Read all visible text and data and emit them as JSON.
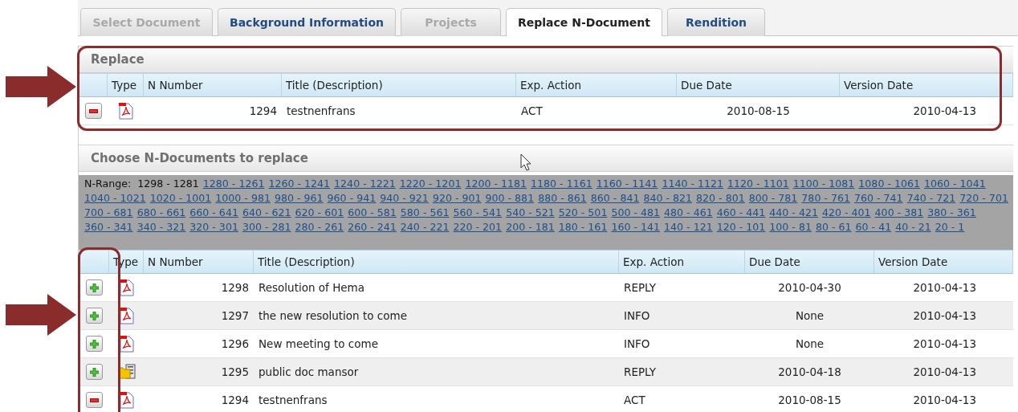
{
  "tabs": [
    {
      "label": "Select Document",
      "selected": false,
      "disabled": true
    },
    {
      "label": "Background Information",
      "selected": false,
      "disabled": false
    },
    {
      "label": "Projects",
      "selected": false,
      "disabled": true
    },
    {
      "label": "Replace N-Document",
      "selected": true,
      "disabled": false
    },
    {
      "label": "Rendition",
      "selected": false,
      "disabled": false
    }
  ],
  "replace": {
    "title": "Replace",
    "columns": [
      "Type",
      "N Number",
      "Title (Description)",
      "Exp. Action",
      "Due Date",
      "Version Date"
    ],
    "rows": [
      {
        "kind": "remove",
        "file": {
          "kind": "pdf"
        },
        "n_number": "1294",
        "title": "testnenfrans",
        "exp_action": "ACT",
        "due_date": "2010-08-15",
        "version_date": "2010-04-13"
      }
    ]
  },
  "choose": {
    "title": "Choose N-Documents to replace",
    "range_label": "N-Range:",
    "ranges": [
      {
        "label": "1298 - 1281",
        "selected": true
      },
      {
        "label": "1280 - 1261",
        "selected": false
      },
      {
        "label": "1260 - 1241",
        "selected": false
      },
      {
        "label": "1240 - 1221",
        "selected": false
      },
      {
        "label": "1220 - 1201",
        "selected": false
      },
      {
        "label": "1200 - 1181",
        "selected": false
      },
      {
        "label": "1180 - 1161",
        "selected": false
      },
      {
        "label": "1160 - 1141",
        "selected": false
      },
      {
        "label": "1140 - 1121",
        "selected": false
      },
      {
        "label": "1120 - 1101",
        "selected": false
      },
      {
        "label": "1100 - 1081",
        "selected": false
      },
      {
        "label": "1080 - 1061",
        "selected": false
      },
      {
        "label": "1060 - 1041",
        "selected": false
      },
      {
        "label": "1040 - 1021",
        "selected": false
      },
      {
        "label": "1020 - 1001",
        "selected": false
      },
      {
        "label": "1000 - 981",
        "selected": false
      },
      {
        "label": "980 - 961",
        "selected": false
      },
      {
        "label": "960 - 941",
        "selected": false
      },
      {
        "label": "940 - 921",
        "selected": false
      },
      {
        "label": "920 - 901",
        "selected": false
      },
      {
        "label": "900 - 881",
        "selected": false
      },
      {
        "label": "880 - 861",
        "selected": false
      },
      {
        "label": "860 - 841",
        "selected": false
      },
      {
        "label": "840 - 821",
        "selected": false
      },
      {
        "label": "820 - 801",
        "selected": false
      },
      {
        "label": "800 - 781",
        "selected": false
      },
      {
        "label": "780 - 761",
        "selected": false
      },
      {
        "label": "760 - 741",
        "selected": false
      },
      {
        "label": "740 - 721",
        "selected": false
      },
      {
        "label": "720 - 701",
        "selected": false
      },
      {
        "label": "700 - 681",
        "selected": false
      },
      {
        "label": "680 - 661",
        "selected": false
      },
      {
        "label": "660 - 641",
        "selected": false
      },
      {
        "label": "640 - 621",
        "selected": false
      },
      {
        "label": "620 - 601",
        "selected": false
      },
      {
        "label": "600 - 581",
        "selected": false
      },
      {
        "label": "580 - 561",
        "selected": false
      },
      {
        "label": "560 - 541",
        "selected": false
      },
      {
        "label": "540 - 521",
        "selected": false
      },
      {
        "label": "520 - 501",
        "selected": false
      },
      {
        "label": "500 - 481",
        "selected": false
      },
      {
        "label": "480 - 461",
        "selected": false
      },
      {
        "label": "460 - 441",
        "selected": false
      },
      {
        "label": "440 - 421",
        "selected": false
      },
      {
        "label": "420 - 401",
        "selected": false
      },
      {
        "label": "400 - 381",
        "selected": false
      },
      {
        "label": "380 - 361",
        "selected": false
      },
      {
        "label": "360 - 341",
        "selected": false
      },
      {
        "label": "340 - 321",
        "selected": false
      },
      {
        "label": "320 - 301",
        "selected": false
      },
      {
        "label": "300 - 281",
        "selected": false
      },
      {
        "label": "280 - 261",
        "selected": false
      },
      {
        "label": "260 - 241",
        "selected": false
      },
      {
        "label": "240 - 221",
        "selected": false
      },
      {
        "label": "220 - 201",
        "selected": false
      },
      {
        "label": "200 - 181",
        "selected": false
      },
      {
        "label": "180 - 161",
        "selected": false
      },
      {
        "label": "160 - 141",
        "selected": false
      },
      {
        "label": "140 - 121",
        "selected": false
      },
      {
        "label": "120 - 101",
        "selected": false
      },
      {
        "label": "100 - 81",
        "selected": false
      },
      {
        "label": "80 - 61",
        "selected": false
      },
      {
        "label": "60 - 41",
        "selected": false
      },
      {
        "label": "40 - 21",
        "selected": false
      },
      {
        "label": "20 - 1",
        "selected": false
      }
    ],
    "columns": [
      "Type",
      "N Number",
      "Title (Description)",
      "Exp. Action",
      "Due Date",
      "Version Date"
    ],
    "rows": [
      {
        "kind": "add",
        "file": {
          "kind": "pdf"
        },
        "n_number": "1298",
        "title": "Resolution of Hema",
        "exp_action": "REPLY",
        "due_date": "2010-04-30",
        "version_date": "2010-04-13"
      },
      {
        "kind": "add",
        "file": {
          "kind": "pdf"
        },
        "n_number": "1297",
        "title": "the new resolution to come",
        "exp_action": "INFO",
        "due_date": "None",
        "version_date": "2010-04-13"
      },
      {
        "kind": "add",
        "file": {
          "kind": "pdf"
        },
        "n_number": "1296",
        "title": "New meeting to come",
        "exp_action": "INFO",
        "due_date": "None",
        "version_date": "2010-04-13"
      },
      {
        "kind": "add",
        "file": {
          "kind": "folder"
        },
        "n_number": "1295",
        "title": "public doc mansor",
        "exp_action": "REPLY",
        "due_date": "2010-04-18",
        "version_date": "2010-04-13"
      },
      {
        "kind": "remove",
        "file": {
          "kind": "pdf"
        },
        "n_number": "1294",
        "title": "testnenfrans",
        "exp_action": "ACT",
        "due_date": "2010-08-15",
        "version_date": "2010-04-13"
      }
    ]
  }
}
